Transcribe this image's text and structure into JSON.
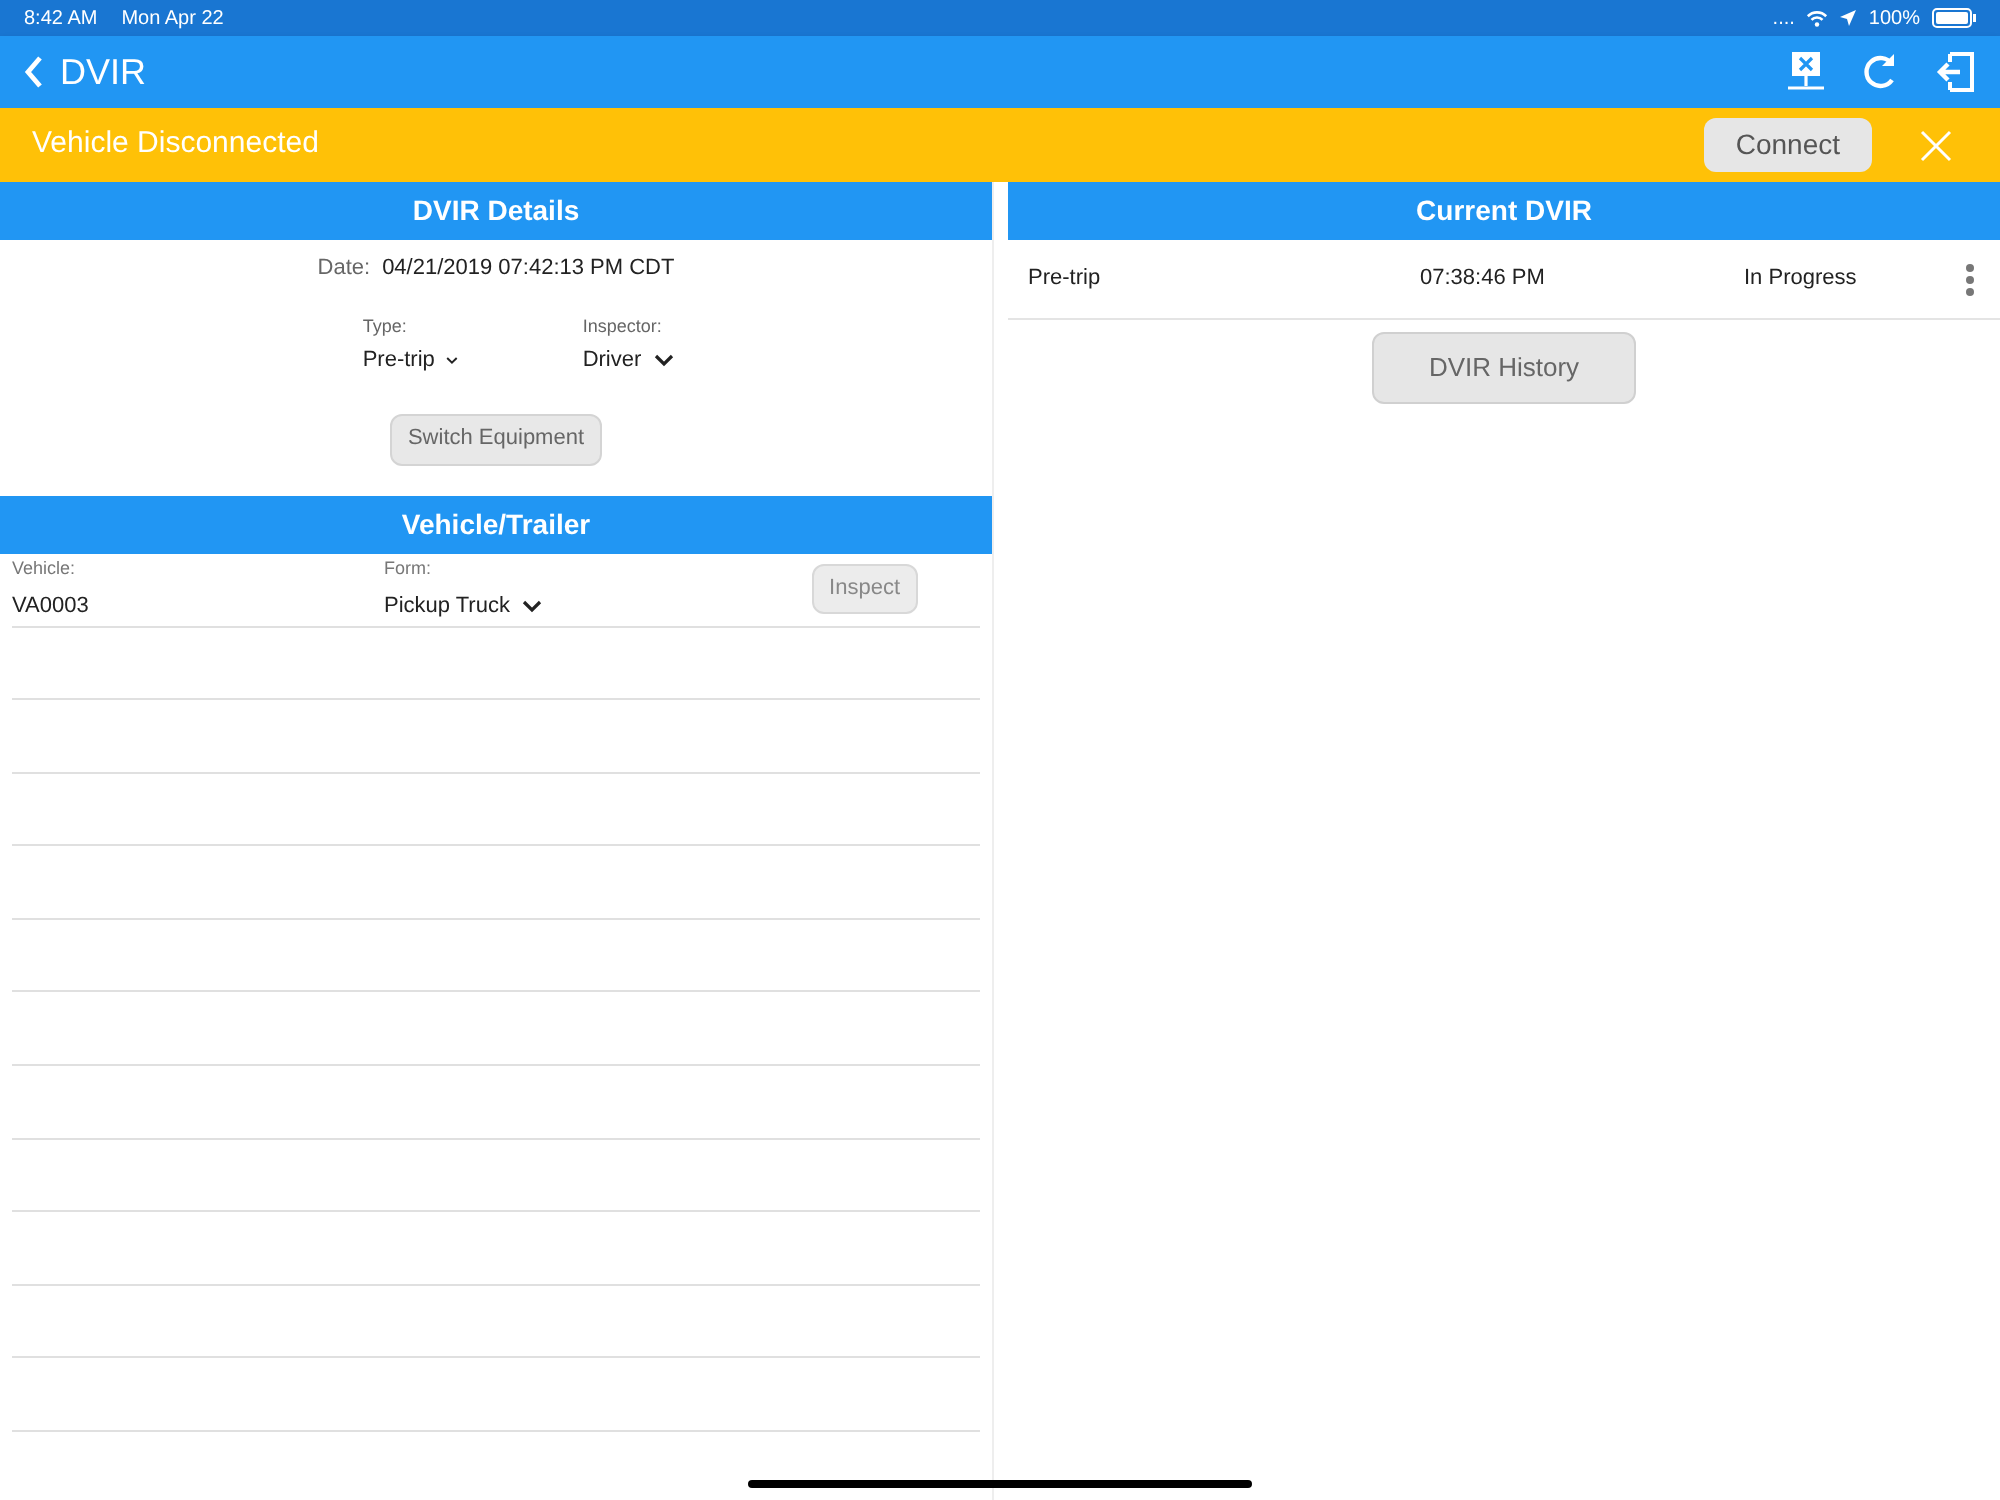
{
  "status_bar": {
    "time": "8:42 AM",
    "date": "Mon Apr 22",
    "signal": "....",
    "battery": "100%"
  },
  "nav": {
    "title": "DVIR"
  },
  "banner": {
    "message": "Vehicle Disconnected",
    "button": "Connect"
  },
  "dvir_details": {
    "title": "DVIR Details",
    "date_label": "Date:",
    "date_value": "04/21/2019 07:42:13 PM CDT",
    "type_label": "Type:",
    "type_value": "Pre-trip",
    "inspector_label": "Inspector:",
    "inspector_value": "Driver",
    "switch_button": "Switch Equipment"
  },
  "vehicle_trailer": {
    "title": "Vehicle/Trailer",
    "vehicle_label": "Vehicle:",
    "vehicle_value": "VA0003",
    "form_label": "Form:",
    "form_value": "Pickup Truck",
    "inspect_button": "Inspect",
    "inspect_disabled": true
  },
  "current_dvir": {
    "title": "Current DVIR",
    "rows": [
      {
        "type": "Pre-trip",
        "time": "07:38:46 PM",
        "status": "In Progress"
      }
    ],
    "history_button": "DVIR History"
  }
}
